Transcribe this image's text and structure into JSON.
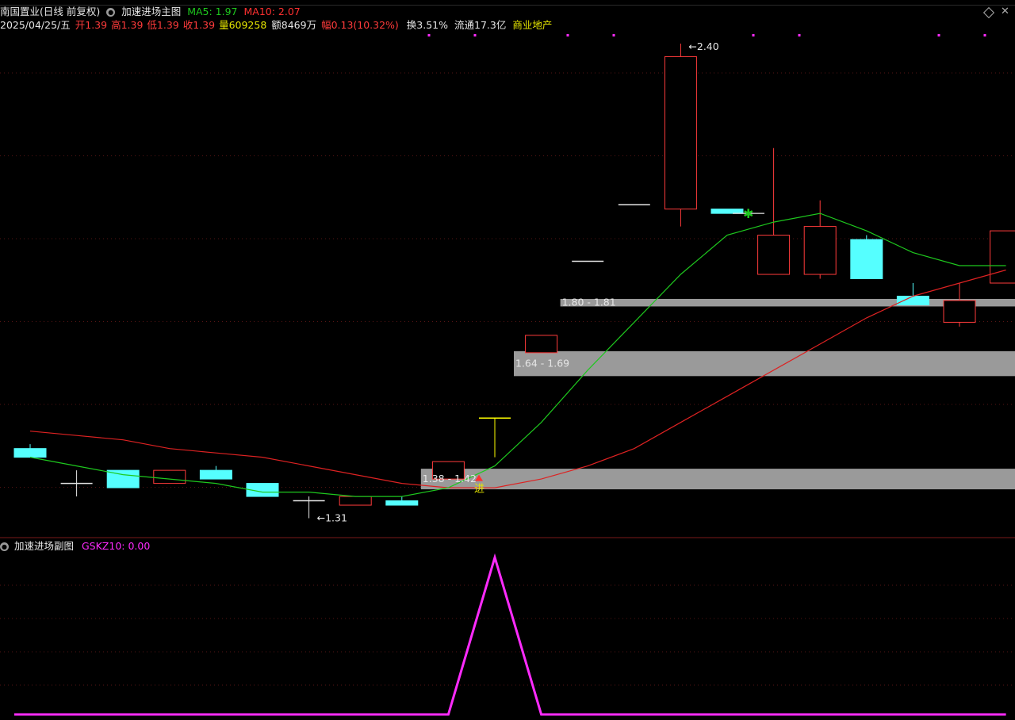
{
  "header": {
    "stock_name": "南国置业(日线 前复权)",
    "indicator_name": "加速进场主图",
    "ma5_label": "MA5: 1.97",
    "ma10_label": "MA10: 2.07",
    "date": "2025/04/25/五",
    "open": "开1.39",
    "high": "高1.39",
    "low": "低1.39",
    "close": "收1.39",
    "volume": "量609258",
    "amount": "额8469万",
    "change": "幅0.13(10.32%)",
    "turnover": "换3.51%",
    "float_cap": "流通17.3亿",
    "sector": "商业地产"
  },
  "sub_panel": {
    "indicator_name": "加速进场副图",
    "value_label": "GSKZ10: 0.00"
  },
  "colors": {
    "up": "#ff3b3b",
    "down": "#55ffff",
    "limit_up": "#ffff00",
    "ma5": "#1ec81e",
    "ma10": "#dd2222",
    "zone": "#9a9a9a",
    "oscillator": "#ff2bff",
    "grid": "#551414"
  },
  "chart_data": [
    {
      "type": "candlestick",
      "title": "加速进场主图",
      "ylim": [
        1.28,
        2.42
      ],
      "candles": [
        {
          "o": 1.47,
          "h": 1.48,
          "l": 1.45,
          "c": 1.45
        },
        {
          "o": 1.39,
          "h": 1.42,
          "l": 1.36,
          "c": 1.39
        },
        {
          "o": 1.42,
          "h": 1.42,
          "l": 1.38,
          "c": 1.38
        },
        {
          "o": 1.39,
          "h": 1.42,
          "l": 1.39,
          "c": 1.42
        },
        {
          "o": 1.42,
          "h": 1.43,
          "l": 1.4,
          "c": 1.4
        },
        {
          "o": 1.39,
          "h": 1.39,
          "l": 1.36,
          "c": 1.36
        },
        {
          "o": 1.35,
          "h": 1.36,
          "l": 1.31,
          "c": 1.35
        },
        {
          "o": 1.34,
          "h": 1.36,
          "l": 1.34,
          "c": 1.36
        },
        {
          "o": 1.35,
          "h": 1.36,
          "l": 1.34,
          "c": 1.34
        },
        {
          "o": 1.4,
          "h": 1.44,
          "l": 1.4,
          "c": 1.44
        },
        {
          "o": 1.54,
          "h": 1.54,
          "l": 1.45,
          "c": 1.54,
          "limit_up": true
        },
        {
          "o": 1.69,
          "h": 1.73,
          "l": 1.69,
          "c": 1.73
        },
        {
          "o": 1.9,
          "h": 1.9,
          "l": 1.9,
          "c": 1.9
        },
        {
          "o": 2.03,
          "h": 2.03,
          "l": 2.03,
          "c": 2.03
        },
        {
          "o": 2.02,
          "h": 2.4,
          "l": 1.98,
          "c": 2.37
        },
        {
          "o": 2.02,
          "h": 2.02,
          "l": 2.01,
          "c": 2.01
        },
        {
          "o": 1.87,
          "h": 2.16,
          "l": 1.87,
          "c": 1.96
        },
        {
          "o": 1.87,
          "h": 2.04,
          "l": 1.86,
          "c": 1.98
        },
        {
          "o": 1.95,
          "h": 1.96,
          "l": 1.86,
          "c": 1.86
        },
        {
          "o": 1.82,
          "h": 1.85,
          "l": 1.8,
          "c": 1.8
        },
        {
          "o": 1.76,
          "h": 1.85,
          "l": 1.75,
          "c": 1.81
        },
        {
          "o": 1.85,
          "h": 1.97,
          "l": 1.85,
          "c": 1.97
        }
      ],
      "ma5": [
        1.45,
        1.43,
        1.41,
        1.4,
        1.39,
        1.37,
        1.37,
        1.36,
        1.36,
        1.38,
        1.43,
        1.53,
        1.65,
        1.76,
        1.87,
        1.96,
        1.99,
        2.01,
        1.97,
        1.92,
        1.89,
        1.89
      ],
      "ma10": [
        1.51,
        1.5,
        1.49,
        1.47,
        1.46,
        1.45,
        1.43,
        1.41,
        1.39,
        1.38,
        1.38,
        1.4,
        1.43,
        1.47,
        1.53,
        1.59,
        1.65,
        1.71,
        1.77,
        1.82,
        1.85,
        1.88
      ],
      "zones": [
        {
          "label": "1.80 - 1.81",
          "low": 1.8,
          "high": 1.81,
          "start": 11
        },
        {
          "label": "1.64 - 1.69",
          "low": 1.64,
          "high": 1.69,
          "start": 10
        },
        {
          "label": "1.38 - 1.42",
          "low": 1.38,
          "high": 1.42,
          "start": 8
        }
      ],
      "annotations": [
        {
          "text": "2.40",
          "index": 14,
          "value": 2.4
        },
        {
          "text": "1.31",
          "index": 6,
          "value": 1.31
        }
      ],
      "signal": {
        "text": "进",
        "index": 10
      }
    },
    {
      "type": "line",
      "title": "加速进场副图",
      "series": [
        {
          "name": "GSKZ10",
          "values": [
            0,
            0,
            0,
            0,
            0,
            0,
            0,
            0,
            0,
            0,
            1,
            0,
            0,
            0,
            0,
            0,
            0,
            0,
            0,
            0,
            0,
            0
          ]
        }
      ]
    }
  ]
}
